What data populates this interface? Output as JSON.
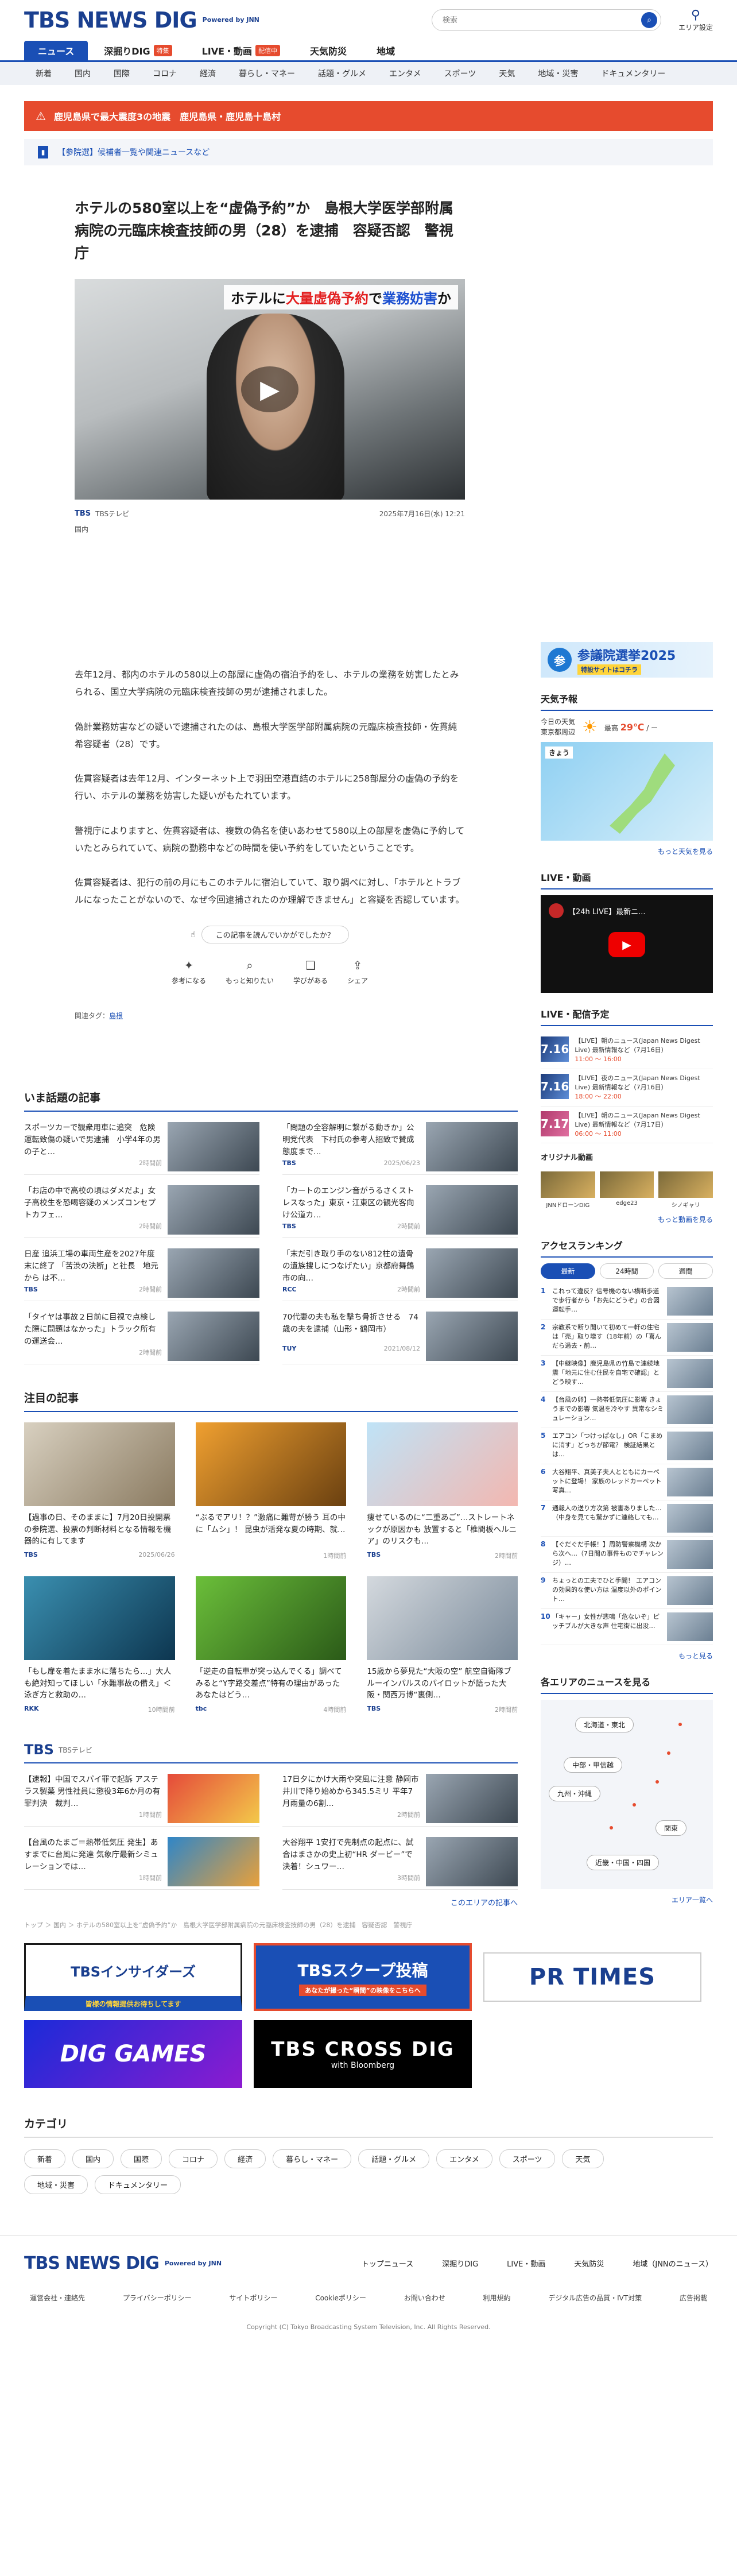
{
  "header": {
    "logo": "TBS NEWS DIG",
    "powered": "Powered by JNN",
    "search_placeholder": "検索",
    "area_label": "エリア設定"
  },
  "nav_primary": [
    {
      "label": "ニュース",
      "badge": ""
    },
    {
      "label": "深掘りDIG",
      "badge": "特集"
    },
    {
      "label": "LIVE・動画",
      "badge": "配信中"
    },
    {
      "label": "天気防災",
      "badge": ""
    },
    {
      "label": "地域",
      "badge": ""
    }
  ],
  "nav_secondary": [
    "新着",
    "国内",
    "国際",
    "コロナ",
    "経済",
    "暮らし・マネー",
    "話題・グルメ",
    "エンタメ",
    "スポーツ",
    "天気",
    "地域・災害",
    "ドキュメンタリー"
  ],
  "alert": {
    "text": "鹿児島県で最大震度3の地震　鹿児島県・鹿児島十島村"
  },
  "notice": {
    "text": "【参院選】候補者一覧や関連ニュースなど"
  },
  "article": {
    "title": "ホテルの580室以上を“虚偽予約”か　島根大学医学部附属病院の元臨床検査技師の男（28）を逮捕　容疑否認　警視庁",
    "video_caption_pre": "ホテルに",
    "video_caption_red": "大量虚偽予約",
    "video_caption_mid": "で",
    "video_caption_blue": "業務妨害",
    "video_caption_end": "か",
    "source": "TBSテレビ",
    "date": "2025年7月16日(水) 12:21",
    "category": "国内",
    "paragraphs": [
      "去年12月、都内のホテルの580以上の部屋に虚偽の宿泊予約をし、ホテルの業務を妨害したとみられる、国立大学病院の元臨床検査技師の男が逮捕されました。",
      "偽計業務妨害などの疑いで逮捕されたのは、島根大学医学部附属病院の元臨床検査技師・佐貫純希容疑者（28）です。",
      "佐貫容疑者は去年12月、インターネット上で羽田空港直結のホテルに258部屋分の虚偽の予約を行い、ホテルの業務を妨害した疑いがもたれています。",
      "警視庁によりますと、佐貫容疑者は、複数の偽名を使いあわせて580以上の部屋を虚偽に予約していたとみられていて、病院の勤務中などの時間を使い予約をしていたということです。",
      "佐貫容疑者は、犯行の前の月にもこのホテルに宿泊していて、取り調べに対し、「ホテルとトラブルになったことがないので、なぜ今回逮捕されたのか理解できません」と容疑を否認しています。"
    ],
    "feedback_question": "この記事を読んでいかがでしたか？",
    "feedback": [
      "参考になる",
      "もっと知りたい",
      "学びがある",
      "シェア"
    ],
    "tags_label": "関連タグ：",
    "tag": "島根"
  },
  "sidebar": {
    "election_title": "参議院選挙2025",
    "election_sub": "特設サイトはコチラ",
    "weather_title": "天気予報",
    "weather_place1": "今日の天気",
    "weather_place2": "東京都周辺",
    "weather_hi_label": "最高",
    "weather_hi": "29℃",
    "weather_lo": "ー",
    "weather_map_label": "きょう",
    "weather_more": "もっと天気を見る",
    "live_title": "LIVE・動画",
    "live_video_title": "【24h LIVE】最新ニ...",
    "schedule_title": "LIVE・配信予定",
    "schedule": [
      {
        "date": "7.16",
        "text": "【LIVE】朝のニュース(Japan News Digest Live) 最新情報など（7月16日）",
        "time": "11:00 〜 16:00"
      },
      {
        "date": "7.16",
        "text": "【LIVE】夜のニュース(Japan News Digest Live) 最新情報など（7月16日）",
        "time": "18:00 〜 22:00"
      },
      {
        "date": "7.17",
        "text": "【LIVE】朝のニュース(Japan News Digest Live) 最新情報など（7月17日）",
        "time": "06:00 〜 11:00"
      }
    ],
    "original_title": "オリジナル動画",
    "original": [
      "JNNドローンDIG",
      "edge23",
      "シノギャリ"
    ],
    "original_more": "もっと動画を見る",
    "ranking_title": "アクセスランキング",
    "ranking_tabs": [
      "最新",
      "24時間",
      "週間"
    ],
    "ranking": [
      "これって違反？信号機のない横断歩道で歩行者から「お先にどうぞ」の合図 運転手…",
      "宗教系で断り聞いて初めて一軒の住宅は「売」取り壊す（18年前）の「喜んだら過去・前…",
      "【中継映像】鹿児島県の竹島で連続地震「地元に住む住民を自宅で確認」とどう映す…",
      "【台風の卵】一熱帯低気圧に影響 きょうまでの影響 気温を冷やす 異常なシミュレーション…",
      "エアコン「つけっぱなし」OR「こまめに消す」どっちが節電？ 検証結果とは…",
      "大谷翔平、真美子夫人とともにカーペットに登場！ 家族のレッドカーペット写真…",
      "通報人の送り方次第 被害ありました…（中身を見ても驚かずに連絡しても…",
      "【ぐだぐだ手帳！】周防警察機構 次から次へ…（7日間の事件ものでチャレンジ）…",
      "ちょっとの工夫でひと手間！ エアコンの効果的な使い方は 温度以外のポイント…",
      "「キャー」女性が悲鳴「危ないぞ」ピッチブルが大きな声 住宅街に出没…"
    ],
    "ranking_more": "もっと見る",
    "area_title": "各エリアのニュースを見る",
    "areas": [
      "北海道・東北",
      "中部・甲信越",
      "九州・沖縄",
      "関東",
      "近畿・中国・四国"
    ],
    "area_more": "エリア一覧へ"
  },
  "trending": {
    "title": "いま話題の記事",
    "items": [
      {
        "text": "スポーツカーで観衆用車に追突　危険運転致傷の疑いで男逮捕　小学4年の男の子と…",
        "src": "",
        "date": "2時間前"
      },
      {
        "text": "「問題の全容解明に繋がる動きか」公明党代表　下村氏の参考人招致で賛成態度まで…",
        "src": "TBS",
        "date": "2025/06/23"
      },
      {
        "text": "「お店の中で高校の頃はダメだよ」女子高校生を恐喝容疑のメンズコンセプトカフェ…",
        "src": "",
        "date": "2時間前"
      },
      {
        "text": "「カートのエンジン音がうるさくストレスなった」東京・江東区の観光客向け公道カ…",
        "src": "TBS",
        "date": "2時間前"
      },
      {
        "text": "日産 追浜工場の車両生産を2027年度末に終了 「苦渋の決断」と社長　地元から は不…",
        "src": "TBS",
        "date": "2時間前"
      },
      {
        "text": "「末だ引き取り手のない812柱の遺骨の遺族捜しにつなげたい」京都府舞鶴市の向…",
        "src": "RCC",
        "date": "2時間前"
      },
      {
        "text": "「タイヤは事故２日前に目視で点検した際に問題はなかった」トラック所有の運送会…",
        "src": "",
        "date": "2時間前"
      },
      {
        "text": "70代妻の夫も私を撃ち骨折させる　74歳の夫を逮捕（山形・鶴岡市）",
        "src": "TUY",
        "date": "2021/08/12"
      }
    ]
  },
  "featured": {
    "title": "注目の記事",
    "items": [
      {
        "text": "【過事の日、そのままに】7月20日投開票の参院選、投票の判断材料となる情報を機器的に有してます",
        "src": "TBS",
        "date": "2025/06/26",
        "thumb": "過事の日、そのままに"
      },
      {
        "text": "“ぶるでアリ！？”激痛に難苛が勝う 耳の中に「ムシ」！ 昆虫が活発な夏の時期、就…",
        "src": "",
        "date": "1時間前",
        "thumb": "耳の中に「ムシ」"
      },
      {
        "text": "痩せているのに“二重あご”…ストレートネックが原因かも 放置すると「椎間板ヘルニア」のリスクも…",
        "src": "TBS",
        "date": "2時間前",
        "thumb": "ストレートネックが原因かも"
      },
      {
        "text": "「もし扉を着たまま水に落ちたら…」大人も絶対知ってほしい「水難事故の備え」＜泳ぎ方と救助の…",
        "src": "RKK",
        "date": "10時間前",
        "thumb": ""
      },
      {
        "text": "「逆走の自転車が突っ込んでくる」調べてみると“Y字路交差点”特有の理由があった あなたはどう…",
        "src": "tbc",
        "date": "4時間前",
        "thumb": "Y字路"
      },
      {
        "text": "15歳から夢見た“大阪の空” 航空自衛隊ブルーインパルスのパイロットが語った大阪・関西万博“裏側…",
        "src": "TBS",
        "date": "2時間前",
        "thumb": ""
      }
    ]
  },
  "tbs_news": {
    "brand": "TBS",
    "sub": "TBSテレビ",
    "items": [
      {
        "text": "【速報】中国でスパイ罪で起訴 アステラス製薬 男性社員に懲役3年6か月の有罪判決　裁判…",
        "date": "1時間前"
      },
      {
        "text": "17日夕にかけ大雨や突風に注意 静岡市井川で降り始めから345.5ミリ 平年7月雨量の6割…",
        "date": "2時間前"
      },
      {
        "text": "【台風のたまご＝熱帯低気圧 発生】あすまでに台風に発達 気象庁最新シミュレーションでは…",
        "date": "1時間前"
      },
      {
        "text": "大谷翔平 1安打で先制点の起点に、試合はまさかの史上初“HR ダービー”で決着！シュワー…",
        "date": "3時間前"
      }
    ],
    "more": "このエリアの記事へ"
  },
  "breadcrumb": "トップ ＞ 国内 ＞ ホテルの580室以上を“虚偽予約”か　島根大学医学部附属病院の元臨床検査技師の男（28）を逮捕　容疑否認　警視庁",
  "banners": {
    "insiders": "TBSインサイダーズ",
    "insiders_sub": "皆様の情報提供お待ちしてます",
    "scoop": "TBSスクープ投稿",
    "scoop_sub": "あなたが撮った“瞬間”の映像をこちらへ",
    "prtimes": "PR TIMES",
    "games": "DIG GAMES",
    "cross": "TBS CROSS DIG",
    "cross_sub": "with Bloomberg"
  },
  "categories": {
    "title": "カテゴリ",
    "items": [
      "新着",
      "国内",
      "国際",
      "コロナ",
      "経済",
      "暮らし・マネー",
      "話題・グルメ",
      "エンタメ",
      "スポーツ",
      "天気",
      "地域・災害",
      "ドキュメンタリー"
    ]
  },
  "footer": {
    "links_top": [
      "トップニュース",
      "深掘りDIG",
      "LIVE・動画",
      "天気防災",
      "地域（JNNのニュース）"
    ],
    "links_bottom": [
      "運営会社・連絡先",
      "プライバシーポリシー",
      "サイトポリシー",
      "Cookieポリシー",
      "お問い合わせ",
      "利用規約",
      "デジタル広告の品質・IVT対策",
      "広告掲載"
    ],
    "copyright": "Copyright (C) Tokyo Broadcasting System Television, Inc. All Rights Reserved."
  }
}
